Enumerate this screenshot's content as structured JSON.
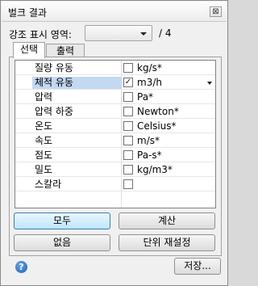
{
  "window": {
    "title": "벌크 결과",
    "close_glyph": "⊠"
  },
  "highlight": {
    "label": "강조 표시 영역:",
    "selected": "",
    "total": "/ 4"
  },
  "tabs": [
    {
      "label": "선택",
      "active": true
    },
    {
      "label": "출력",
      "active": false
    }
  ],
  "rows": [
    {
      "name": "질량 유동",
      "checked": false,
      "unit": "kg/s*"
    },
    {
      "name": "체적 유동",
      "checked": true,
      "unit": "m3/h",
      "selected": true
    },
    {
      "name": "압력",
      "checked": false,
      "unit": "Pa*"
    },
    {
      "name": "압력 하중",
      "checked": false,
      "unit": "Newton*"
    },
    {
      "name": "온도",
      "checked": false,
      "unit": "Celsius*"
    },
    {
      "name": "속도",
      "checked": false,
      "unit": "m/s*"
    },
    {
      "name": "점도",
      "checked": false,
      "unit": "Pa-s*"
    },
    {
      "name": "밀도",
      "checked": false,
      "unit": "kg/m3*"
    },
    {
      "name": "스칼라",
      "checked": false,
      "unit": ""
    }
  ],
  "buttons": {
    "all": "모두",
    "calculate": "계산",
    "none": "없음",
    "unit_reset": "단위 재설정",
    "save": "저장..."
  },
  "icons": {
    "help": "?",
    "check": "✓"
  }
}
